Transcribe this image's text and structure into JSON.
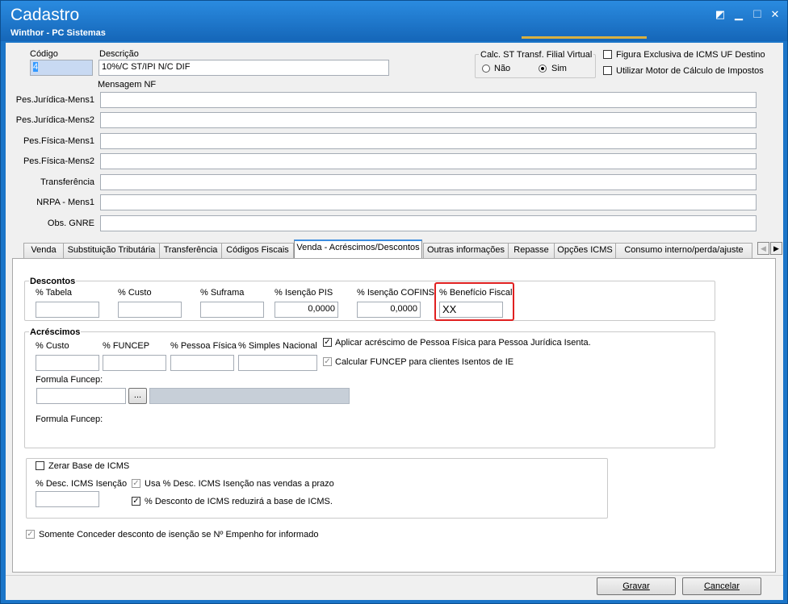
{
  "window": {
    "title": "Cadastro",
    "subtitle": "Winthor - PC Sistemas"
  },
  "header": {
    "codigo_label": "Código",
    "codigo_value": "4",
    "descricao_label": "Descrição",
    "descricao_value": "10%/C ST/IPI N/C DIF",
    "calc_st_title": "Calc. ST Transf. Filial Virtual",
    "calc_st_nao": "Não",
    "calc_st_sim": "Sim",
    "calc_st_selected": "Sim",
    "figura_exclusiva": "Figura Exclusiva de ICMS UF Destino",
    "utilizar_motor": "Utilizar Motor de Cálculo de Impostos",
    "mensagem_nf_label": "Mensagem NF"
  },
  "messages": [
    {
      "label": "Pes.Jurídica-Mens1",
      "value": ""
    },
    {
      "label": "Pes.Jurídica-Mens2",
      "value": ""
    },
    {
      "label": "Pes.Física-Mens1",
      "value": ""
    },
    {
      "label": "Pes.Física-Mens2",
      "value": ""
    },
    {
      "label": "Transferência",
      "value": ""
    },
    {
      "label": "NRPA - Mens1",
      "value": ""
    },
    {
      "label": "Obs. GNRE",
      "value": ""
    }
  ],
  "tabs": [
    {
      "label": "Venda"
    },
    {
      "label": "Substituição Tributária"
    },
    {
      "label": "Transferência"
    },
    {
      "label": "Códigos Fiscais"
    },
    {
      "label": "Venda - Acréscimos/Descontos",
      "active": true
    },
    {
      "label": "Outras informações"
    },
    {
      "label": "Repasse"
    },
    {
      "label": "Opções ICMS"
    },
    {
      "label": "Consumo interno/perda/ajuste"
    }
  ],
  "descontos": {
    "title": "Descontos",
    "fields": [
      {
        "label": "% Tabela",
        "value": ""
      },
      {
        "label": "% Custo",
        "value": ""
      },
      {
        "label": "% Suframa",
        "value": ""
      },
      {
        "label": "% Isenção PIS",
        "value": "0,0000"
      },
      {
        "label": "% Isenção COFINS",
        "value": "0,0000"
      },
      {
        "label": "% Benefício Fiscal",
        "value": "XX"
      }
    ]
  },
  "acrescimos": {
    "title": "Acréscimos",
    "fields": [
      {
        "label": "% Custo",
        "value": ""
      },
      {
        "label": "% FUNCEP",
        "value": ""
      },
      {
        "label": "% Pessoa Física",
        "value": ""
      },
      {
        "label": "% Simples Nacional",
        "value": ""
      }
    ],
    "aplicar_acrescimo": "Aplicar acréscimo de Pessoa Física para Pessoa Jurídica Isenta.",
    "calcular_funcep": "Calcular FUNCEP para clientes Isentos de IE",
    "formula_funcep_label": "Formula Funcep:",
    "formula_funcep_label2": "Formula Funcep:",
    "ellipsis": "..."
  },
  "icms": {
    "zerar_base": "Zerar Base de ICMS",
    "desc_isencao_label": "% Desc. ICMS Isenção",
    "usa_desc": "Usa % Desc. ICMS Isenção nas vendas a prazo",
    "desconto_reduz": "% Desconto de ICMS reduzirá a base de ICMS."
  },
  "somente_conceder": "Somente Conceder desconto de isenção se Nº Empenho for informado",
  "buttons": {
    "gravar": "Gravar",
    "cancelar": "Cancelar"
  },
  "colors": {
    "titlebar": "#1b75c8",
    "highlight_box": "#e02020"
  }
}
